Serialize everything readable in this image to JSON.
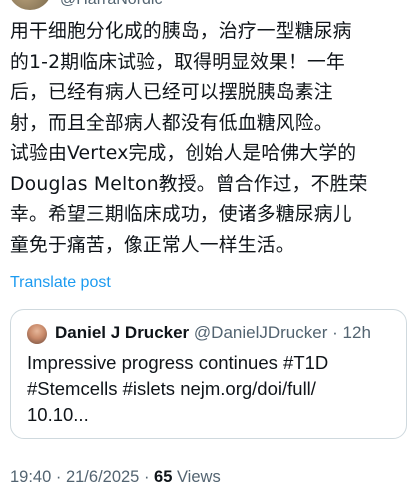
{
  "author": {
    "handle": "@HarraNordic"
  },
  "post": {
    "text": "用干细胞分化成的胰岛，治疗一型糖尿病\n的1-2期临床试验，取得明显效果！一年\n后，已经有病人已经可以摆脱胰岛素注\n射，而且全部病人都没有低血糖风险。\n试验由Vertex完成，创始人是哈佛大学的\nDouglas Melton教授。曾合作过，不胜荣\n幸。希望三期临床成功，使诸多糖尿病儿\n童免于痛苦，像正常人一样生活。",
    "translate_label": "Translate post"
  },
  "quote": {
    "name": "Daniel J Drucker",
    "handle": "@DanielJDrucker",
    "dot": "·",
    "time": "12h",
    "text": "Impressive progress continues #T1D\n#Stemcells #islets nejm.org/doi/full/\n10.10..."
  },
  "meta": {
    "timestamp": "19:40 · 21/6/2025 · ",
    "views_count": "65",
    "views_label": " Views"
  }
}
